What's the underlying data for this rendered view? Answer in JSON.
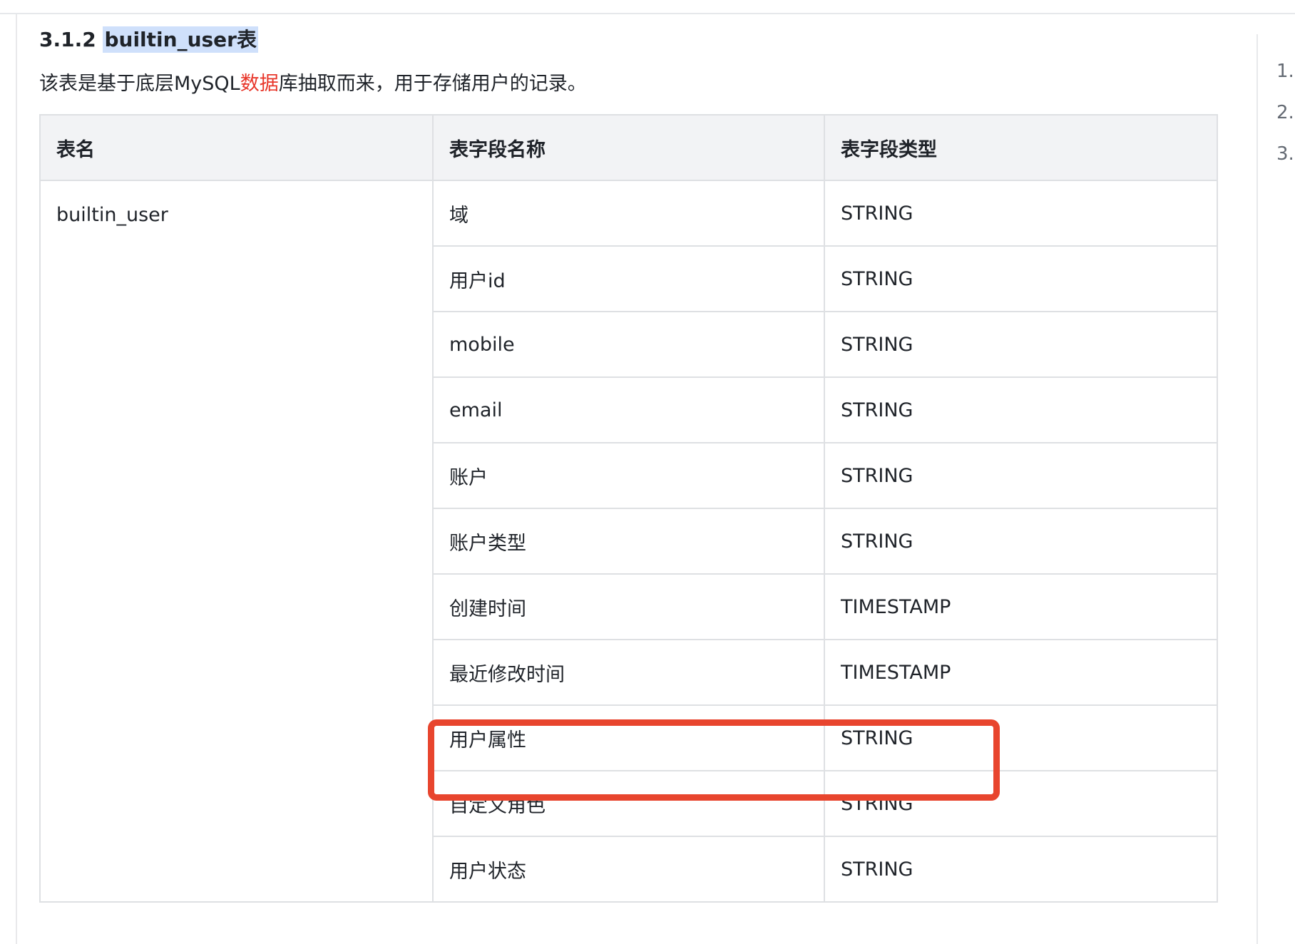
{
  "heading": {
    "number": "3.1.2",
    "title": "builtin_user表"
  },
  "description": {
    "before": "该表是基于底层MySQL",
    "highlight": "数据",
    "after": "库抽取而来，用于存储用户的记录。"
  },
  "toc": [
    "1.",
    "2.",
    "3."
  ],
  "table": {
    "headers": [
      "表名",
      "表字段名称",
      "表字段类型"
    ],
    "name": "builtin_user",
    "rows": [
      {
        "field": "域",
        "type": "STRING"
      },
      {
        "field": "用户id",
        "type": "STRING"
      },
      {
        "field": "mobile",
        "type": "STRING"
      },
      {
        "field": "email",
        "type": "STRING"
      },
      {
        "field": "账户",
        "type": "STRING"
      },
      {
        "field": "账户类型",
        "type": "STRING"
      },
      {
        "field": "创建时间",
        "type": "TIMESTAMP"
      },
      {
        "field": "最近修改时间",
        "type": "TIMESTAMP"
      },
      {
        "field": "用户属性",
        "type": "STRING"
      },
      {
        "field": "自定义角色",
        "type": "STRING"
      },
      {
        "field": "用户状态",
        "type": "STRING"
      }
    ]
  },
  "colors": {
    "highlight_bg": "#cfe0fb",
    "link_red": "#e8362a",
    "callout_red": "#e8452e",
    "header_bg": "#f2f3f5",
    "border": "#dee0e3"
  }
}
